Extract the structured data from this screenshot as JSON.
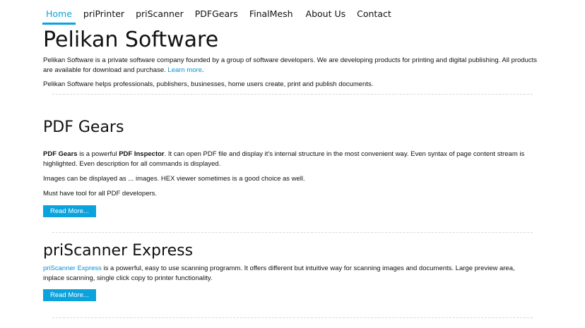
{
  "nav": {
    "items": [
      {
        "label": "Home",
        "active": true
      },
      {
        "label": "priPrinter"
      },
      {
        "label": "priScanner"
      },
      {
        "label": "PDFGears"
      },
      {
        "label": "FinalMesh"
      },
      {
        "label": "About Us"
      },
      {
        "label": "Contact"
      }
    ]
  },
  "intro": {
    "title": "Pelikan Software",
    "p1_text": "Pelikan Software is a private software company founded by a group of software developers. We are developing products for printing and digital publishing. All products are available for download and purchase. ",
    "p1_link": "Learn more",
    "p1_end": ".",
    "p2": "Pelikan Software helps professionals, publishers, businesses, home users create, print and publish documents."
  },
  "pdfgears": {
    "title": "PDF Gears",
    "p1_bold1": "PDF Gears",
    "p1_mid": " is a powerful ",
    "p1_bold2": "PDF Inspector",
    "p1_rest": ". It can open PDF file and display it's internal structure in the most convenient way. Even syntax of page content stream is highlighted. Even description for all commands is displayed.",
    "p2": "Images can be displayed as ... images. HEX viewer sometimes is a good choice as well.",
    "p3": "Must have tool for all PDF developers.",
    "button": "Read More..."
  },
  "priscanner": {
    "title": "priScanner Express",
    "p1_link": "priScanner Express",
    "p1_rest": " is a powerful, easy to use scanning programm. It offers different but intuitive way for scanning images and documents. Large preview area, inplace scanning, single click copy to printer functionality.",
    "button": "Read More..."
  }
}
